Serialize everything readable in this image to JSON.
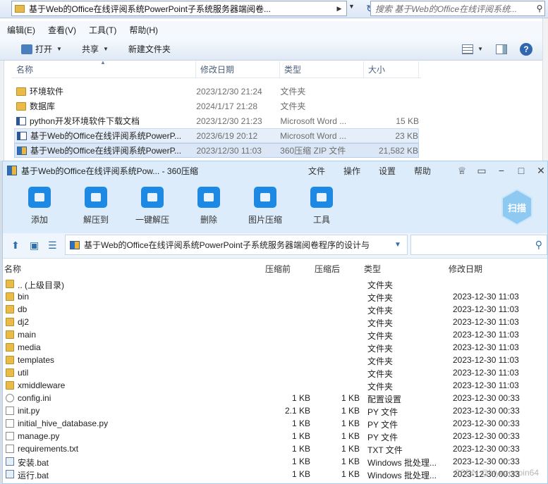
{
  "explorer": {
    "address_path": "基于Web的Office在线评阅系统PowerPoint子系统服务器端阅卷...",
    "search_placeholder": "搜索 基于Web的Office在线评阅系统...",
    "menu": [
      "编辑(E)",
      "查看(V)",
      "工具(T)",
      "帮助(H)"
    ],
    "toolbar": {
      "open": "打开",
      "share": "共享",
      "new_folder": "新建文件夹"
    },
    "columns": {
      "name": "名称",
      "modified": "修改日期",
      "type": "类型",
      "size": "大小"
    },
    "rows": [
      {
        "icon": "folder-icon",
        "name": "环境软件",
        "date": "2023/12/30 21:24",
        "type": "文件夹",
        "size": ""
      },
      {
        "icon": "folder-icon",
        "name": "数据库",
        "date": "2024/1/17 21:28",
        "type": "文件夹",
        "size": ""
      },
      {
        "icon": "word-doc-icon",
        "name": "python开发环境软件下载文档",
        "date": "2023/12/30 21:23",
        "type": "Microsoft Word ...",
        "size": "15 KB"
      },
      {
        "icon": "word-doc-icon",
        "name": "基于Web的Office在线评阅系统PowerP...",
        "date": "2023/6/19 20:12",
        "type": "Microsoft Word ...",
        "size": "23 KB"
      },
      {
        "icon": "zip-icon",
        "name": "基于Web的Office在线评阅系统PowerP...",
        "date": "2023/12/30 11:03",
        "type": "360压缩 ZIP 文件",
        "size": "21,582 KB"
      }
    ]
  },
  "zip": {
    "title": "基于Web的Office在线评阅系统Pow... - 360压缩",
    "menus": [
      "文件",
      "操作",
      "设置",
      "帮助"
    ],
    "tools": [
      {
        "label": "添加",
        "icon": "add-icon",
        "color": "#1e88e5"
      },
      {
        "label": "解压到",
        "icon": "extract-to-icon",
        "color": "#1e88e5"
      },
      {
        "label": "一键解压",
        "icon": "one-click-extract-icon",
        "color": "#1e88e5"
      },
      {
        "label": "删除",
        "icon": "delete-icon",
        "color": "#1e88e5"
      },
      {
        "label": "图片压缩",
        "icon": "image-compress-icon",
        "color": "#1e88e5"
      },
      {
        "label": "工具",
        "icon": "tools-icon",
        "color": "#1e88e5"
      }
    ],
    "scan_label": "扫描",
    "path": "基于Web的Office在线评阅系统PowerPoint子系统服务器端阅卷程序的设计与",
    "columns": {
      "name": "名称",
      "packed": "压缩前",
      "unpacked": "压缩后",
      "type": "类型",
      "modified": "修改日期"
    },
    "rows": [
      {
        "icon": "folder",
        "name": ".. (上级目录)",
        "packed": "",
        "unpacked": "",
        "type": "文件夹",
        "date": ""
      },
      {
        "icon": "folder",
        "name": "bin",
        "packed": "",
        "unpacked": "",
        "type": "文件夹",
        "date": "2023-12-30 11:03"
      },
      {
        "icon": "folder",
        "name": "db",
        "packed": "",
        "unpacked": "",
        "type": "文件夹",
        "date": "2023-12-30 11:03"
      },
      {
        "icon": "folder",
        "name": "dj2",
        "packed": "",
        "unpacked": "",
        "type": "文件夹",
        "date": "2023-12-30 11:03"
      },
      {
        "icon": "folder",
        "name": "main",
        "packed": "",
        "unpacked": "",
        "type": "文件夹",
        "date": "2023-12-30 11:03"
      },
      {
        "icon": "folder",
        "name": "media",
        "packed": "",
        "unpacked": "",
        "type": "文件夹",
        "date": "2023-12-30 11:03"
      },
      {
        "icon": "folder",
        "name": "templates",
        "packed": "",
        "unpacked": "",
        "type": "文件夹",
        "date": "2023-12-30 11:03"
      },
      {
        "icon": "folder",
        "name": "util",
        "packed": "",
        "unpacked": "",
        "type": "文件夹",
        "date": "2023-12-30 11:03"
      },
      {
        "icon": "folder",
        "name": "xmiddleware",
        "packed": "",
        "unpacked": "",
        "type": "文件夹",
        "date": "2023-12-30 11:03"
      },
      {
        "icon": "gear",
        "name": "config.ini",
        "packed": "1 KB",
        "unpacked": "1 KB",
        "type": "配置设置",
        "date": "2023-12-30 00:33"
      },
      {
        "icon": "file",
        "name": "init.py",
        "packed": "2.1 KB",
        "unpacked": "1 KB",
        "type": "PY 文件",
        "date": "2023-12-30 00:33"
      },
      {
        "icon": "file",
        "name": "initial_hive_database.py",
        "packed": "1 KB",
        "unpacked": "1 KB",
        "type": "PY 文件",
        "date": "2023-12-30 00:33"
      },
      {
        "icon": "file",
        "name": "manage.py",
        "packed": "1 KB",
        "unpacked": "1 KB",
        "type": "PY 文件",
        "date": "2023-12-30 00:33"
      },
      {
        "icon": "file",
        "name": "requirements.txt",
        "packed": "1 KB",
        "unpacked": "1 KB",
        "type": "TXT 文件",
        "date": "2023-12-30 00:33"
      },
      {
        "icon": "bat",
        "name": "安装.bat",
        "packed": "1 KB",
        "unpacked": "1 KB",
        "type": "Windows 批处理...",
        "date": "2023-12-30 00:33"
      },
      {
        "icon": "bat",
        "name": "运行.bat",
        "packed": "1 KB",
        "unpacked": "1 KB",
        "type": "Windows 批处理...",
        "date": "2023-12-30 00:33"
      }
    ],
    "watermark": "CSDN @biyezuopin64"
  }
}
